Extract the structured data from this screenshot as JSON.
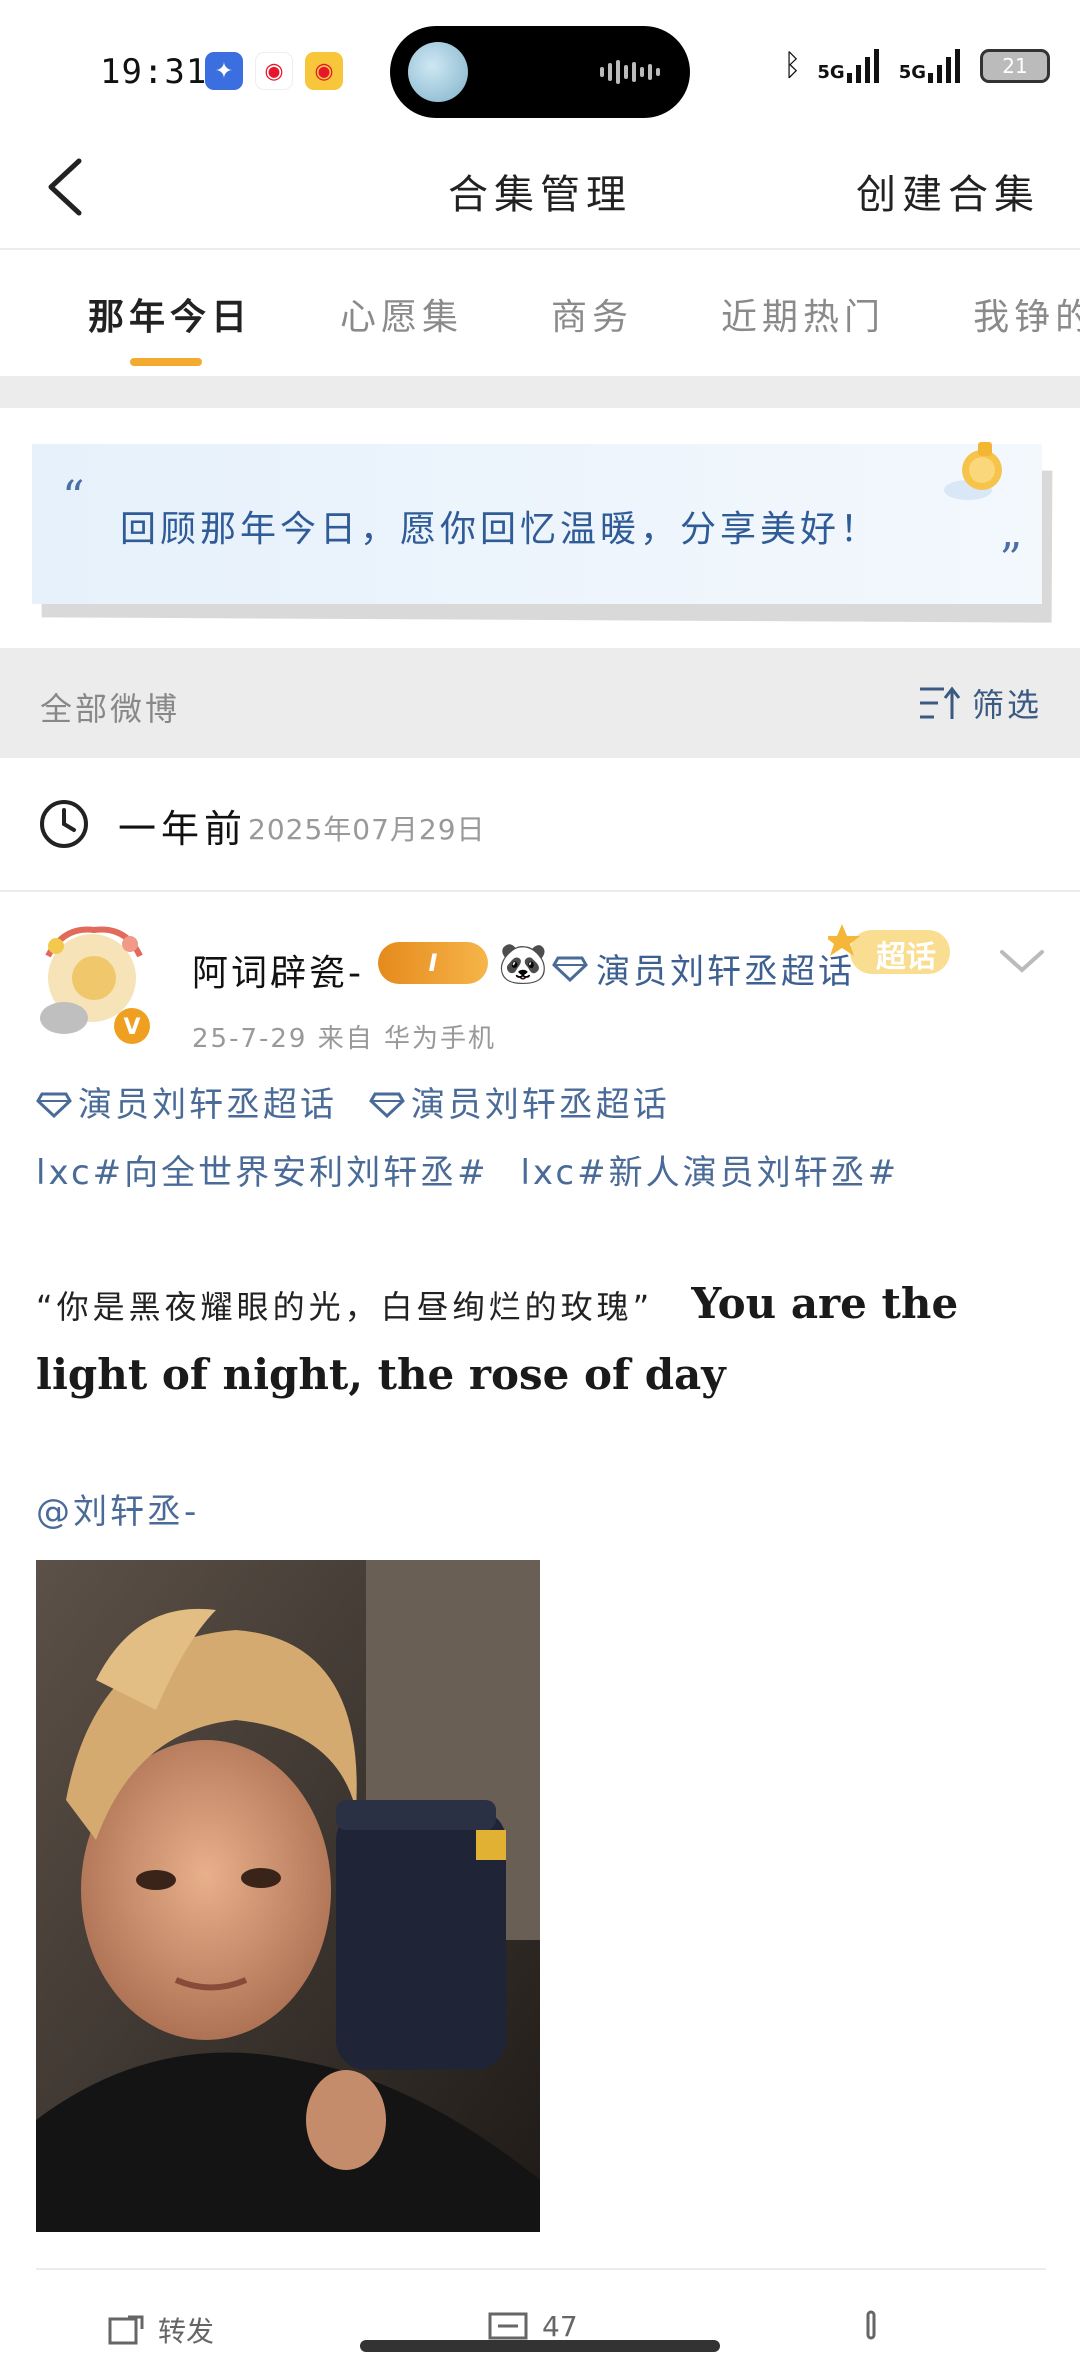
{
  "status_bar": {
    "time": "19:31",
    "signal_1": "5G",
    "signal_2": "5G",
    "battery": "21"
  },
  "header": {
    "title": "合集管理",
    "action": "创建合集"
  },
  "tabs": [
    {
      "label": "那年今日",
      "active": true
    },
    {
      "label": "心愿集"
    },
    {
      "label": "商务"
    },
    {
      "label": "近期热门"
    },
    {
      "label": "我铮的"
    }
  ],
  "banner": {
    "text": "回顾那年今日，愿你回忆温暖，分享美好！",
    "quote_open": "“",
    "quote_close": "”"
  },
  "filter": {
    "left_label": "全部微博",
    "right_label": "筛选"
  },
  "time_group": {
    "label": "一年前",
    "date": "2025年07月29日"
  },
  "post": {
    "username": "阿词辟瓷-",
    "level_badge": "I",
    "topic_top": "演员刘轩丞超话",
    "super_badge": "超话",
    "meta": "25-7-29  来自  华为手机",
    "tags_line": [
      "演员刘轩丞超话",
      "演员刘轩丞超话",
      "lxc#向全世界安利刘轩丞#",
      "lxc#新人演员刘轩丞#"
    ],
    "body_cn": "“你是黑夜耀眼的光，白昼绚烂的玫瑰”",
    "body_en": "You are the light of night, the rose of day",
    "mention": "@刘轩丞-",
    "actions": {
      "repost": "转发",
      "comment": "47"
    }
  },
  "colors": {
    "accent": "#f4a92f",
    "link": "#4a6b98",
    "banner_text": "#2f5b97"
  }
}
